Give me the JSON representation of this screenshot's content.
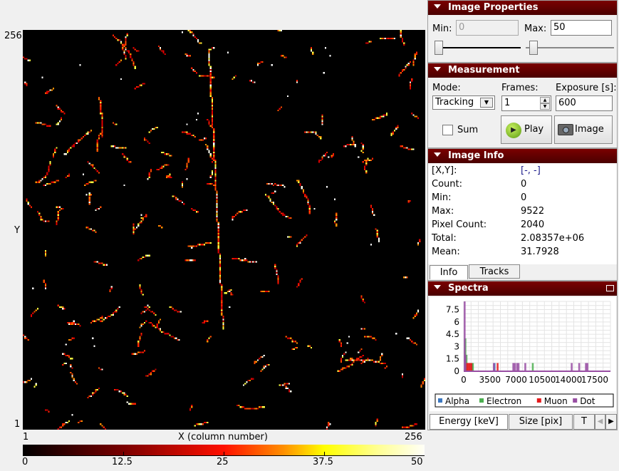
{
  "image_view": {
    "y_top_label": "256",
    "y_axis_label": "Y",
    "y_bottom_label": "1",
    "x_left_label": "1",
    "x_axis_label": "X (column number)",
    "x_right_label": "256",
    "colorbar_ticks": [
      "0",
      "12.5",
      "25",
      "37.5",
      "50"
    ],
    "colormap": [
      "#000000",
      "#7a0000",
      "#ff1000",
      "#ff9000",
      "#ffff00",
      "#fffff8"
    ]
  },
  "image_properties": {
    "title": "Image Properties",
    "min_label": "Min:",
    "min_value": "0",
    "max_label": "Max:",
    "max_value": "50",
    "min_slider_fraction": 0.0,
    "max_slider_fraction": 0.2
  },
  "measurement": {
    "title": "Measurement",
    "mode_label": "Mode:",
    "mode_value": "Tracking",
    "frames_label": "Frames:",
    "frames_value": "1",
    "exposure_label": "Exposure [s]:",
    "exposure_value": "600",
    "sum_label": "Sum",
    "sum_checked": false,
    "play_label": "Play",
    "image_label": "Image"
  },
  "image_info": {
    "title": "Image Info",
    "rows": [
      {
        "label": "[X,Y]:",
        "value": "[-, -]"
      },
      {
        "label": "Count:",
        "value": "0"
      },
      {
        "label": "Min:",
        "value": "0"
      },
      {
        "label": "Max:",
        "value": "9522"
      },
      {
        "label": "Pixel Count:",
        "value": "2040"
      },
      {
        "label": "Total:",
        "value": "2.08357e+06"
      },
      {
        "label": "Mean:",
        "value": "31.7928"
      }
    ],
    "tabs": [
      "Info",
      "Tracks"
    ],
    "active_tab": "Info"
  },
  "spectra": {
    "title": "Spectra",
    "tabs": [
      "Energy [keV]",
      "Size [pix]",
      "T"
    ],
    "active_tab": "Energy [keV]"
  },
  "chart_data": {
    "type": "bar",
    "xlim": [
      0,
      19600
    ],
    "ylim": [
      0,
      8.5
    ],
    "x_ticks": [
      "0",
      "3500",
      "7000",
      "10500",
      "14000",
      "17500"
    ],
    "y_ticks": [
      "0",
      "1.5",
      "3",
      "4.5",
      "6",
      "7.5"
    ],
    "grid": true,
    "legend_position": "bottom",
    "series": [
      {
        "name": "Alpha",
        "color": "#3c78c0",
        "points": [
          [
            4000,
            1
          ]
        ]
      },
      {
        "name": "Electron",
        "color": "#4caf50",
        "points": [
          [
            100,
            4
          ],
          [
            250,
            2
          ],
          [
            1000,
            1
          ],
          [
            1100,
            1
          ],
          [
            9100,
            1
          ]
        ]
      },
      {
        "name": "Muon",
        "color": "#e41a1c",
        "points": [
          [
            300,
            1
          ],
          [
            450,
            1
          ],
          [
            600,
            1
          ],
          [
            750,
            1
          ],
          [
            900,
            1
          ],
          [
            4400,
            1
          ]
        ]
      },
      {
        "name": "Dot",
        "color": "#984ea3",
        "points": [
          [
            0,
            8.5
          ],
          [
            100,
            2
          ],
          [
            3900,
            1
          ],
          [
            6500,
            1
          ],
          [
            6700,
            1
          ],
          [
            7000,
            1
          ],
          [
            7200,
            1
          ],
          [
            8100,
            1
          ],
          [
            14300,
            1
          ],
          [
            15300,
            1
          ],
          [
            16200,
            1
          ],
          [
            16400,
            1
          ]
        ]
      }
    ]
  }
}
